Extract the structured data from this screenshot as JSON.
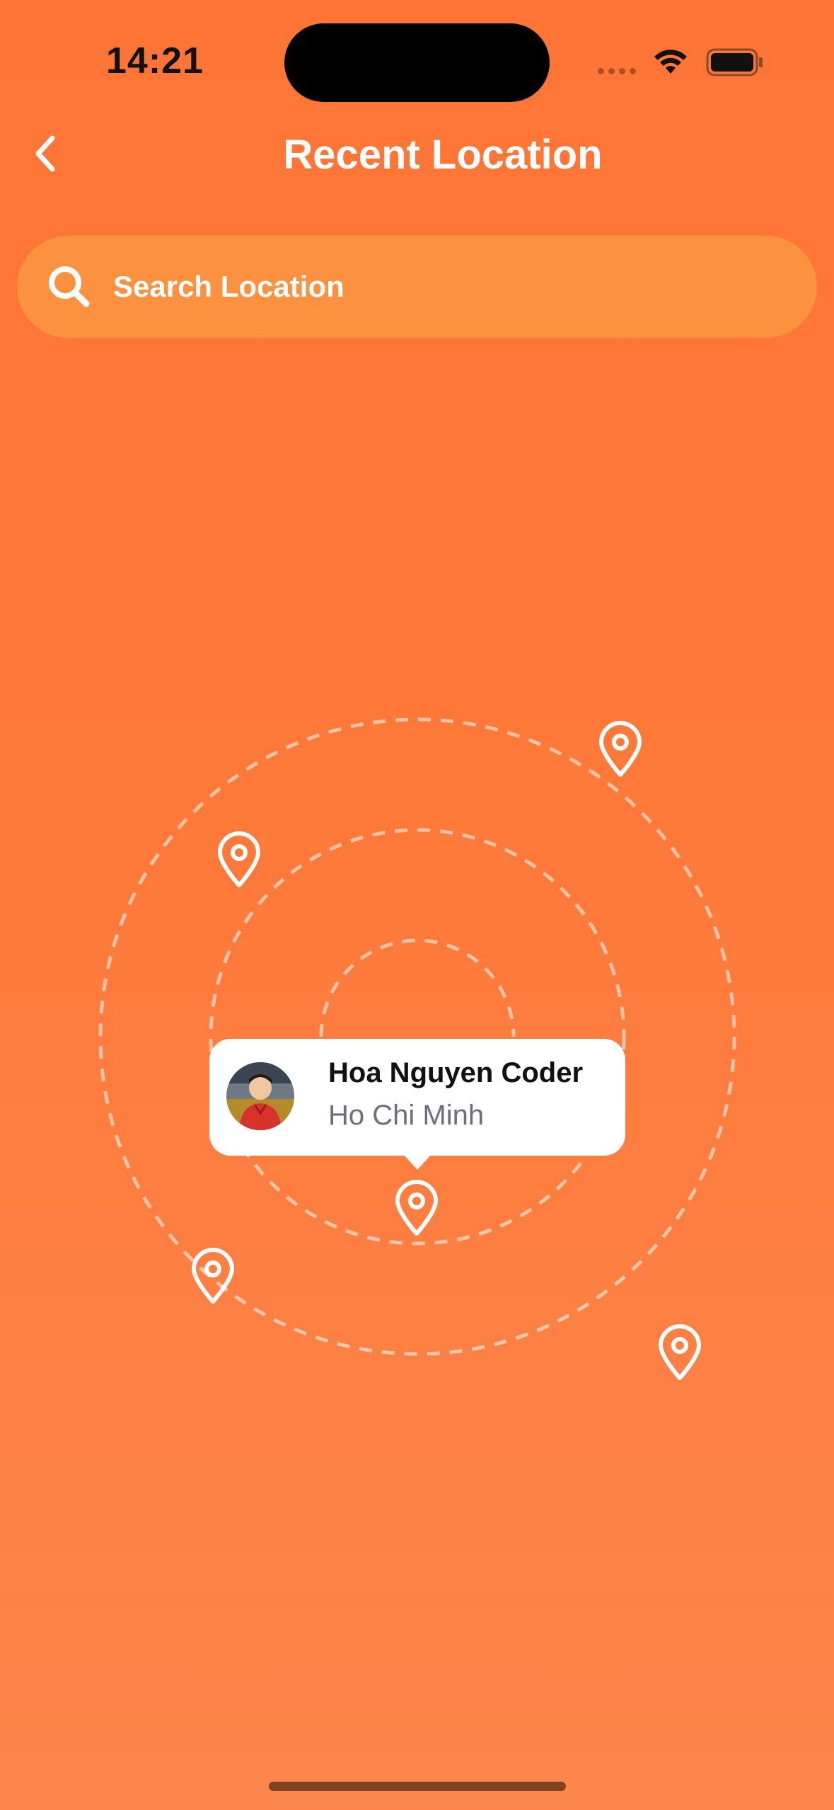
{
  "status_bar": {
    "time": "14:21",
    "icons": [
      "cellular-signal-icon",
      "wifi-icon",
      "battery-icon"
    ]
  },
  "header": {
    "back_icon": "chevron-left-icon",
    "title": "Recent Location"
  },
  "search": {
    "icon": "search-icon",
    "placeholder": "Search Location",
    "value": ""
  },
  "map": {
    "rings": 3,
    "pins": [
      {
        "icon": "map-pin-icon"
      },
      {
        "icon": "map-pin-icon"
      },
      {
        "icon": "map-pin-icon"
      },
      {
        "icon": "map-pin-icon"
      },
      {
        "icon": "map-pin-icon"
      }
    ]
  },
  "callout": {
    "name": "Hoa Nguyen Coder",
    "location": "Ho Chi Minh",
    "avatar": "user-avatar"
  },
  "colors": {
    "background_top": "#FF7535",
    "background_bottom": "#FC864C",
    "search_background": "#FC9240",
    "card_background": "#FFFFFF",
    "name_text": "#111111",
    "location_text": "#6E6E80"
  }
}
